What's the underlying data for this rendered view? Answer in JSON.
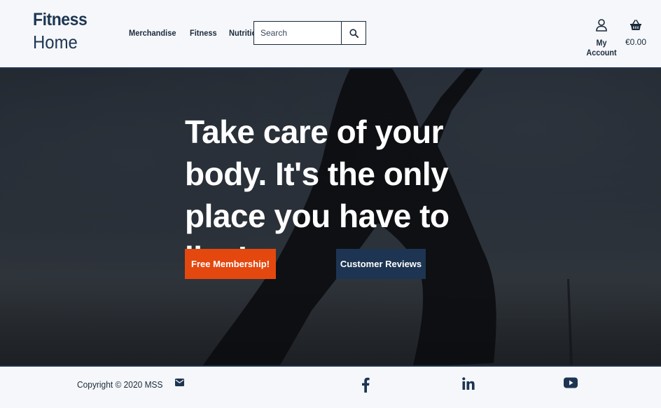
{
  "brand": {
    "line1": "Fitness",
    "line2": "Home"
  },
  "nav": {
    "items": [
      {
        "label": "Merchandise"
      },
      {
        "label": "Fitness"
      },
      {
        "label": "Nutrition"
      }
    ]
  },
  "search": {
    "placeholder": "Search",
    "value": ""
  },
  "account": {
    "label": "My Account",
    "icon": "user-icon"
  },
  "basket": {
    "total": "€0.00",
    "icon": "basket-icon"
  },
  "hero": {
    "title": "Take care of your body. It's the only place you have to live!",
    "primary_button": "Free Membership!",
    "secondary_button": "Customer Reviews"
  },
  "footer": {
    "copyright": "Copyright © 2020 MSS",
    "icons": [
      "envelope-icon",
      "facebook-icon",
      "linkedin-icon",
      "youtube-icon"
    ]
  },
  "colors": {
    "brand_navy": "#1d3552",
    "accent_orange": "#e4480f",
    "background": "#f5f7fa"
  }
}
